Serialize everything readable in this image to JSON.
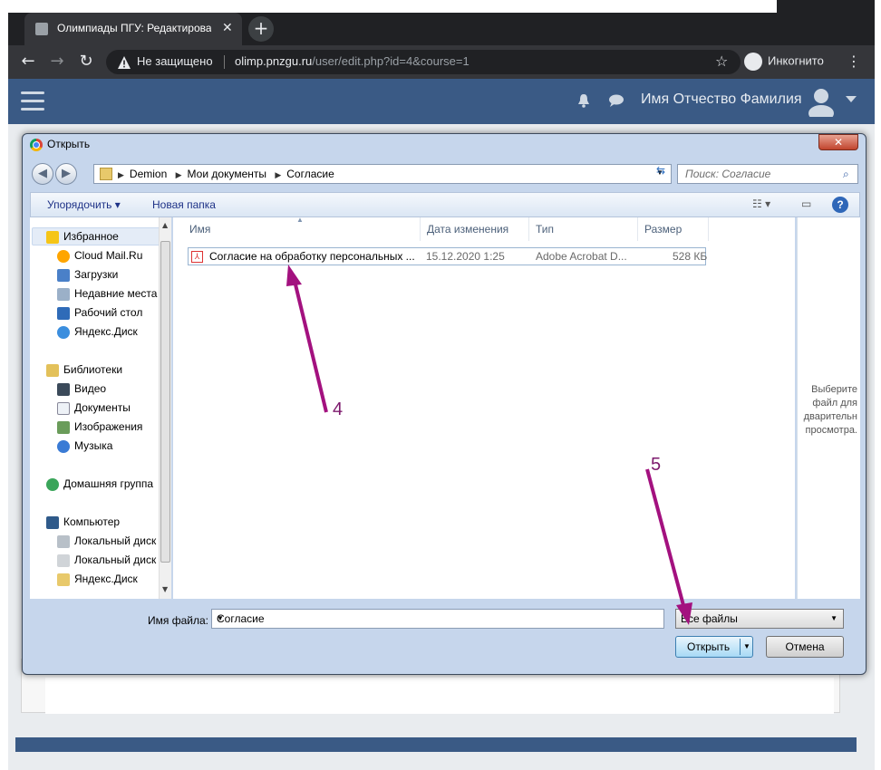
{
  "browser": {
    "tab_title": "Олимпиады ПГУ: Редактироват",
    "not_secure": "Не защищено",
    "url_host": "olimp.pnzgu.ru",
    "url_path": "/user/edit.php?id=4&course=1",
    "incognito": "Инкогнито"
  },
  "page": {
    "user_name": "Имя Отчество Фамилия"
  },
  "dialog": {
    "title": "Открыть",
    "breadcrumb": [
      "Demion",
      "Мои документы",
      "Согласие"
    ],
    "search_placeholder": "Поиск: Согласие",
    "organize": "Упорядочить",
    "new_folder": "Новая папка",
    "nav": {
      "favorites": "Избранное",
      "cloud": "Cloud Mail.Ru",
      "downloads": "Загрузки",
      "recent": "Недавние места",
      "desktop": "Рабочий стол",
      "yadisk": "Яндекс.Диск",
      "libraries": "Библиотеки",
      "video": "Видео",
      "documents": "Документы",
      "images": "Изображения",
      "music": "Музыка",
      "homegroup": "Домашняя группа",
      "computer": "Компьютер",
      "local_c": "Локальный диск",
      "local_d": "Локальный диск",
      "yadisk2": "Яндекс.Диск"
    },
    "columns": {
      "name": "Имя",
      "date": "Дата изменения",
      "type": "Тип",
      "size": "Размер"
    },
    "file": {
      "name": "Согласие на обработку персональных ...",
      "date": "15.12.2020 1:25",
      "type": "Adobe Acrobat D...",
      "size": "528 КБ"
    },
    "preview": [
      "Выберите",
      "файл для",
      "дварительн",
      "просмотра."
    ],
    "filename_label": "Имя файла:",
    "filename_value": "Согласие",
    "filetype": "Все файлы",
    "open": "Открыть",
    "cancel": "Отмена"
  },
  "annotations": {
    "step4": "4",
    "step5": "5",
    "color": "#a3117f"
  }
}
